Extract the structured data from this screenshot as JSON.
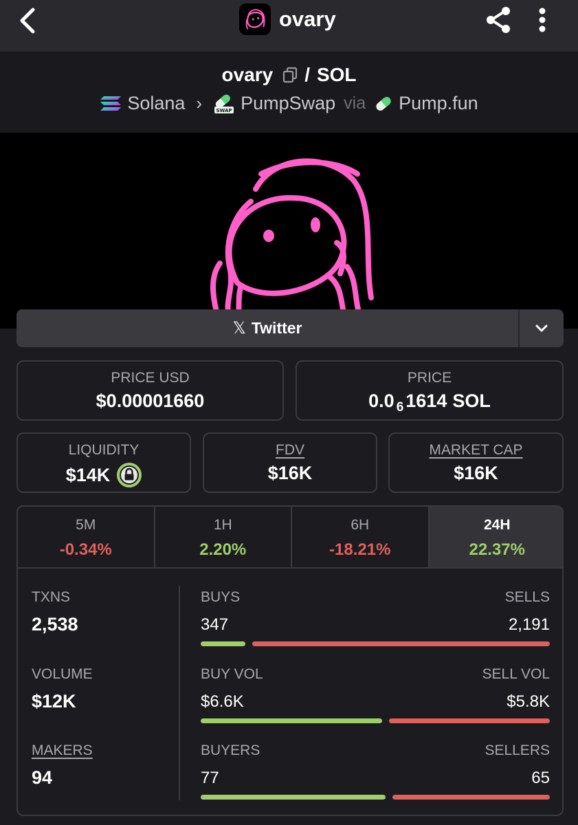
{
  "header": {
    "back_icon": "chevron-left-icon",
    "app_name": "ovary",
    "share_icon": "share-icon",
    "more_icon": "more-vertical-icon"
  },
  "pair": {
    "token": "ovary",
    "separator": "/",
    "quote": "SOL",
    "chain": "Solana",
    "dex": "PumpSwap",
    "via": "via",
    "launchpad": "Pump.fun",
    "dex_badge": "SWAP"
  },
  "colors": {
    "accent_pink": "#ff5fc8",
    "positive": "#9fcf69",
    "negative": "#e0605b"
  },
  "socials": {
    "twitter_label": "Twitter",
    "twitter_glyph": "𝕏"
  },
  "price": {
    "usd_label": "PRICE USD",
    "usd_value": "$0.00001660",
    "native_label": "PRICE",
    "native_prefix": "0.0",
    "native_subscript": "6",
    "native_digits": "1614",
    "native_unit": "SOL"
  },
  "metrics": {
    "liquidity_label": "LIQUIDITY",
    "liquidity_value": "$14K",
    "fdv_label": "FDV",
    "fdv_value": "$16K",
    "mcap_label": "MARKET CAP",
    "mcap_value": "$16K"
  },
  "timeframes": [
    {
      "label": "5M",
      "change": "-0.34%",
      "trend": "negative"
    },
    {
      "label": "1H",
      "change": "2.20%",
      "trend": "positive"
    },
    {
      "label": "6H",
      "change": "-18.21%",
      "trend": "negative"
    },
    {
      "label": "24H",
      "change": "22.37%",
      "trend": "positive",
      "selected": true
    }
  ],
  "stats": {
    "txns_label": "TXNS",
    "txns_value": "2,538",
    "volume_label": "VOLUME",
    "volume_value": "$12K",
    "makers_label": "MAKERS",
    "makers_value": "94",
    "buys_label": "BUYS",
    "buys_value": "347",
    "sells_label": "SELLS",
    "sells_value": "2,191",
    "buy_vol_label": "BUY VOL",
    "buy_vol_value": "$6.6K",
    "sell_vol_label": "SELL VOL",
    "sell_vol_value": "$5.8K",
    "buyers_label": "BUYERS",
    "buyers_value": "77",
    "sellers_label": "SELLERS",
    "sellers_value": "65",
    "buys_fraction": 0.137,
    "buy_vol_fraction": 0.53,
    "buyers_fraction": 0.54
  }
}
